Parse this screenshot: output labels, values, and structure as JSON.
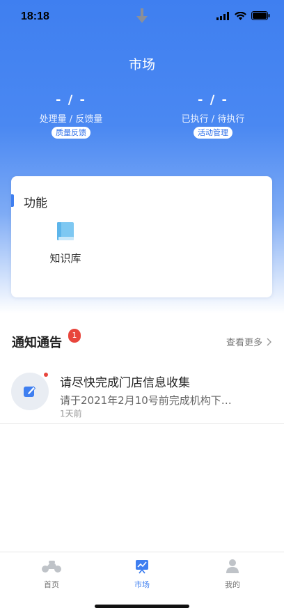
{
  "status_bar": {
    "time": "18:18"
  },
  "header": {
    "title": "市场"
  },
  "stats": [
    {
      "value": "- / -",
      "label": "处理量 / 反馈量",
      "button": "质量反馈"
    },
    {
      "value": "- / -",
      "label": "已执行 / 待执行",
      "button": "活动管理"
    }
  ],
  "functions": {
    "title": "功能",
    "items": [
      {
        "label": "知识库",
        "icon": "book-icon"
      }
    ]
  },
  "notices": {
    "title": "通知通告",
    "badge": "1",
    "more": "查看更多",
    "items": [
      {
        "title": "请尽快完成门店信息收集",
        "summary": "请于2021年2月10号前完成机构下…",
        "time": "1天前",
        "icon": "edit-icon",
        "unread": true
      }
    ]
  },
  "tabbar": {
    "items": [
      {
        "label": "首页",
        "icon": "motorcycle-icon",
        "active": false
      },
      {
        "label": "市场",
        "icon": "chart-board-icon",
        "active": true
      },
      {
        "label": "我的",
        "icon": "user-icon",
        "active": false
      }
    ]
  },
  "colors": {
    "primary": "#3f7ff0",
    "badge": "#e8453c"
  }
}
